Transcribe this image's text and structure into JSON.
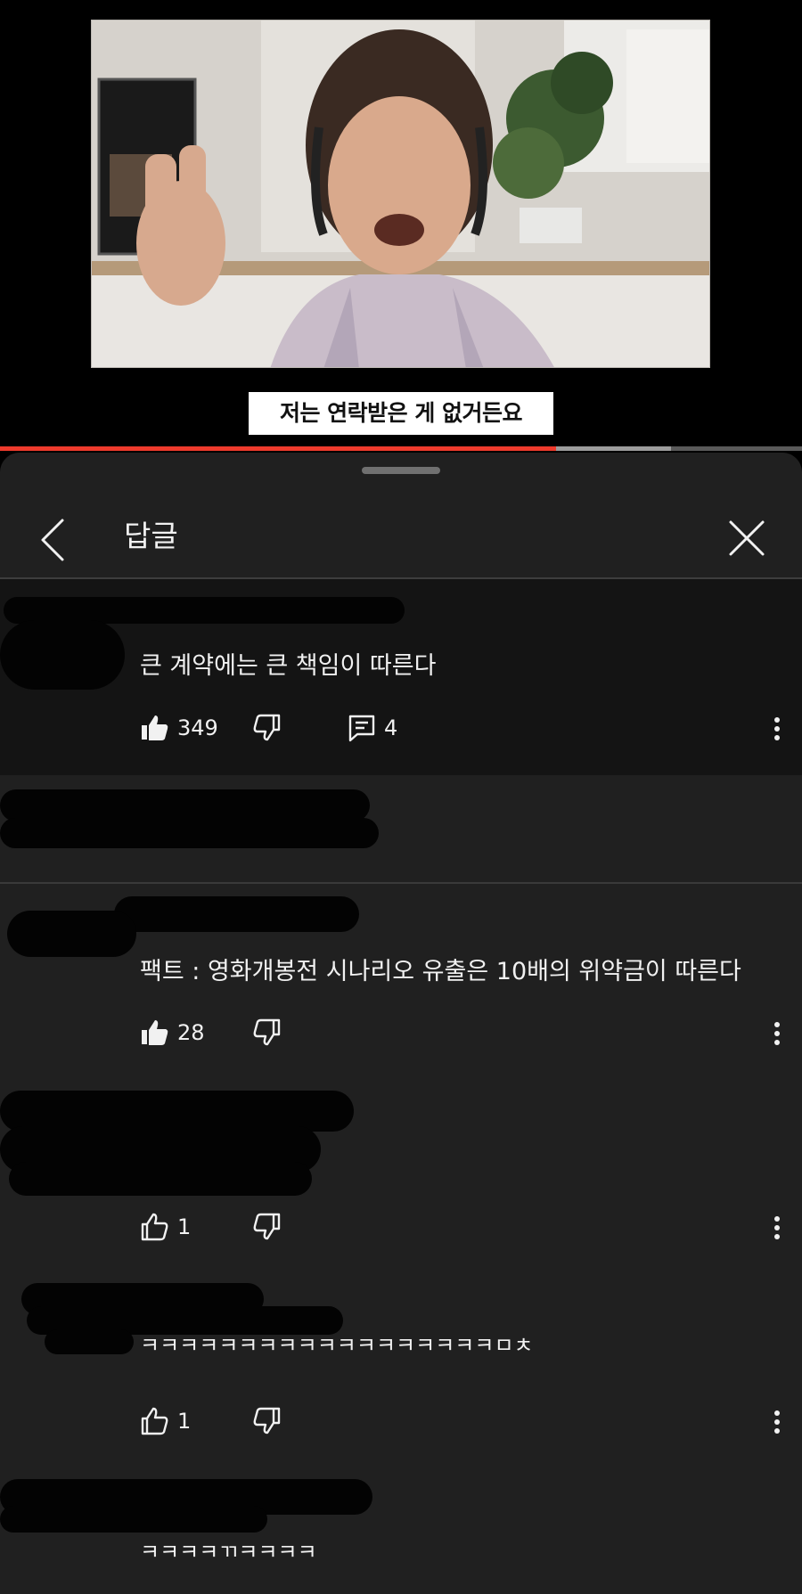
{
  "video": {
    "subtitle": "저는 연락받은 게 없거든요",
    "progress_played": 0.693,
    "progress_buffered": 0.837
  },
  "sheet": {
    "title": "답글",
    "back_icon": "chevron-left-icon",
    "close_icon": "close-icon"
  },
  "comments": [
    {
      "text": "큰 계약에는 큰 책임이 따른다",
      "likes": "349",
      "replies": "4",
      "liked": true
    },
    {
      "text": "팩트 : 영화개봉전 시나리오 유출은 10배의 위약금이 따른다",
      "likes": "28",
      "liked": true
    },
    {
      "text": "",
      "likes": "1",
      "liked": false
    },
    {
      "text": "ㅋㅋㅋㅋㅋㅋㅋㅋㅋㅋㅋㅋㅋㅋㅋㅋㅋㅋㅁㅊ",
      "likes": "1",
      "liked": false
    },
    {
      "text": "ㅋㅋㅋㅋㄲㅋㅋㅋㅋ"
    }
  ],
  "colors": {
    "progress_red": "#ee3a2c",
    "sheet_bg": "#202020",
    "parent_bg": "#141414"
  }
}
